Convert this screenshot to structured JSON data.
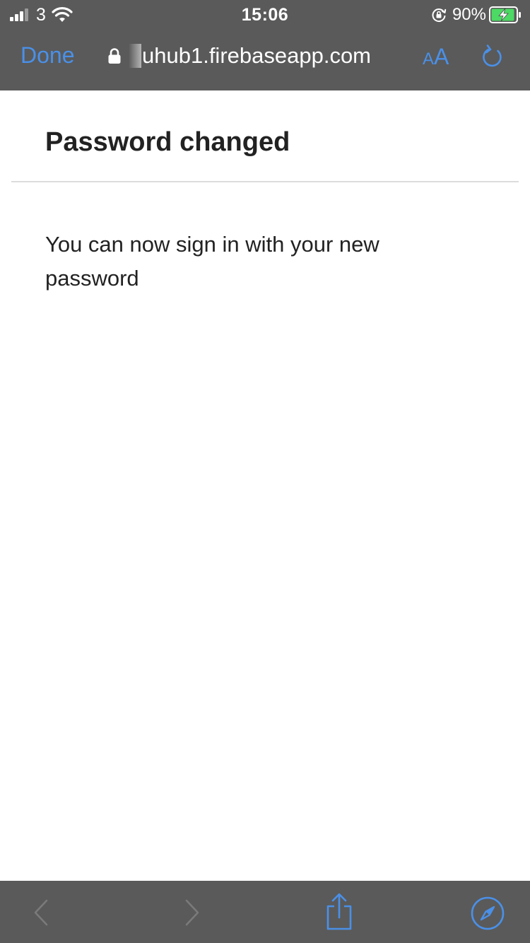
{
  "status_bar": {
    "carrier": "3",
    "time": "15:06",
    "battery_percent": "90%",
    "signal_bars_active": 3,
    "signal_bars_total": 4,
    "charging": true
  },
  "browser": {
    "done_label": "Done",
    "url": "uhub1.firebaseapp.com",
    "text_size_label_small": "A",
    "text_size_label_large": "A",
    "accent_color": "#4a90e8",
    "chrome_color": "#5a5a5a"
  },
  "page": {
    "title": "Password changed",
    "message": "You can now sign in with your new password"
  },
  "toolbar": {
    "back_enabled": false,
    "forward_enabled": false,
    "icons": [
      "chevron-left-icon",
      "chevron-right-icon",
      "share-icon",
      "compass-icon"
    ]
  }
}
